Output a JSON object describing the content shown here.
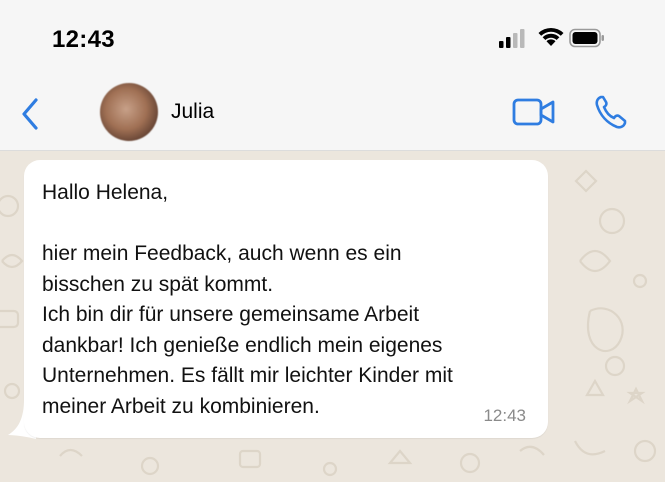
{
  "status_bar": {
    "time": "12:43",
    "icons": [
      "signal-icon",
      "wifi-icon",
      "battery-icon"
    ]
  },
  "header": {
    "contact_name": "Julia",
    "back_icon": "chevron-left-icon",
    "video_icon": "video-camera-icon",
    "call_icon": "phone-icon",
    "accent_color": "#2f7de1"
  },
  "chat": {
    "messages": [
      {
        "text": "Hallo Helena,\n\nhier mein  Feedback, auch wenn es ein\nbisschen zu spät kommt.\nIch bin dir für unsere gemeinsame Arbeit\ndankbar! Ich genieße endlich mein eigenes\nUnternehmen. Es fällt mir leichter Kinder mit\nmeiner Arbeit zu kombinieren.",
        "time": "12:43",
        "direction": "incoming"
      }
    ],
    "wallpaper_color": "#ece6dd",
    "bubble_color": "#ffffff"
  }
}
